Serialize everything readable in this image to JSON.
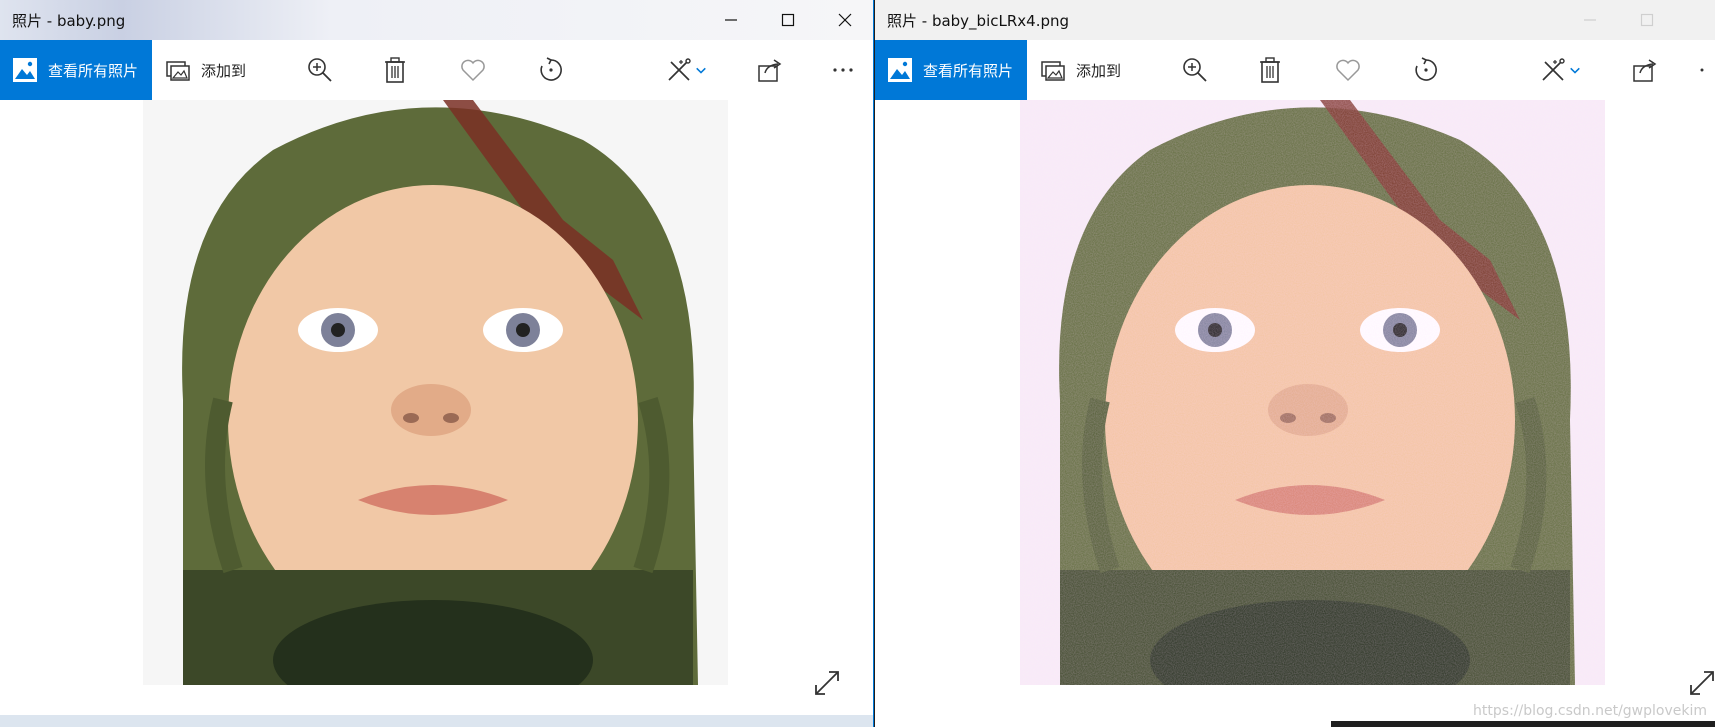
{
  "left_window": {
    "title": "照片 - baby.png",
    "toolbar": {
      "see_all_label": "查看所有照片",
      "add_to_label": "添加到"
    }
  },
  "right_window": {
    "title": "照片 - baby_bicLRx4.png",
    "toolbar": {
      "see_all_label": "查看所有照片",
      "add_to_label": "添加到"
    }
  },
  "watermark": "https://blog.csdn.net/gwplovekim",
  "colors": {
    "accent": "#0078d7",
    "icon": "#333333",
    "favorite_disabled": "#999999"
  }
}
